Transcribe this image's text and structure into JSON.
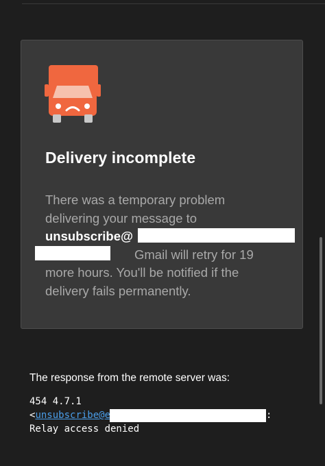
{
  "card": {
    "icon": "delivery-truck-sad-icon",
    "title": "Delivery incomplete",
    "body_line1": "There was a temporary problem",
    "body_line2": "delivering your message to",
    "recipient_prefix": "unsubscribe@",
    "body_line4_rest": "Gmail will retry for 19",
    "body_line5": "more hours. You'll be notified if the",
    "body_line6": "delivery fails permanently."
  },
  "response": {
    "label": "The response from the remote server was:",
    "line1": "454 4.7.1",
    "line2_open": "<",
    "line2_link": "unsubscribe@e",
    "line2_close": ":",
    "line3": "Relay access denied"
  },
  "colors": {
    "background": "#1e1e1e",
    "card": "#393939",
    "truck": "#f0673f",
    "link": "#4a9eea"
  }
}
